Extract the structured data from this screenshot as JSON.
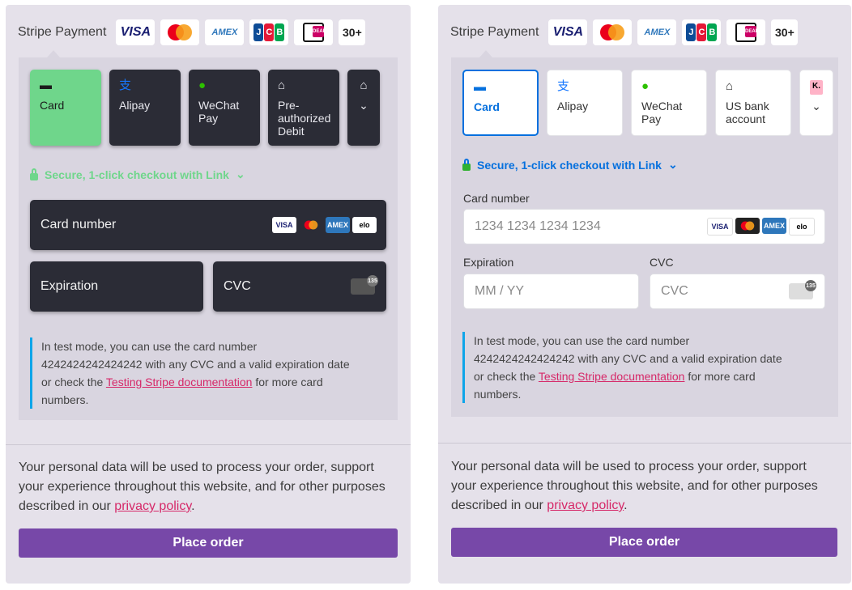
{
  "header": {
    "title": "Stripe Payment",
    "brands": [
      "VISA",
      "JCB",
      "30+"
    ],
    "amex_label": "AMEX",
    "ideal_label": "iDEAL"
  },
  "left": {
    "tabs": [
      {
        "label": "Card",
        "icon": "card-icon"
      },
      {
        "label": "Alipay",
        "icon": "alipay-icon"
      },
      {
        "label": "WeChat Pay",
        "icon": "wechat-icon"
      },
      {
        "label": "Pre-authorized Debit",
        "icon": "bank-icon"
      }
    ],
    "link_text": "Secure, 1-click checkout with Link",
    "card_number_label": "Card number",
    "expiration_label": "Expiration",
    "cvc_label": "CVC"
  },
  "right": {
    "tabs": [
      {
        "label": "Card",
        "icon": "card-icon"
      },
      {
        "label": "Alipay",
        "icon": "alipay-icon"
      },
      {
        "label": "WeChat Pay",
        "icon": "wechat-icon"
      },
      {
        "label": "US bank account",
        "icon": "bank-icon"
      }
    ],
    "more_tab_label": "K.",
    "link_text": "Secure, 1-click checkout with Link",
    "card_number_label": "Card number",
    "card_number_placeholder": "1234 1234 1234 1234",
    "expiration_label": "Expiration",
    "expiration_placeholder": "MM / YY",
    "cvc_label": "CVC",
    "cvc_placeholder": "CVC"
  },
  "card_brands": [
    "VISA",
    "MC",
    "AMEX",
    "elo"
  ],
  "cvc_badge": "135",
  "test_note": {
    "line1": "In test mode, you can use the card number",
    "line2": "4242424242424242 with any CVC and a valid expiration date",
    "line3_prefix": "or check the ",
    "link": "Testing Stripe documentation",
    "line3_suffix": " for more card",
    "line4": "numbers."
  },
  "privacy": {
    "line1": "Your personal data will be used to process your order, support",
    "line2": "your experience throughout this website, and for other purposes",
    "line3_prefix": "described in our ",
    "link": "privacy policy",
    "line3_suffix": "."
  },
  "place_order_label": "Place order",
  "colors": {
    "panel_bg": "#e5e1ea",
    "dark_field": "#2b2c36",
    "dark_accent": "#6fd68b",
    "light_accent": "#0570de",
    "button": "#7748a8",
    "link": "#d62868"
  }
}
